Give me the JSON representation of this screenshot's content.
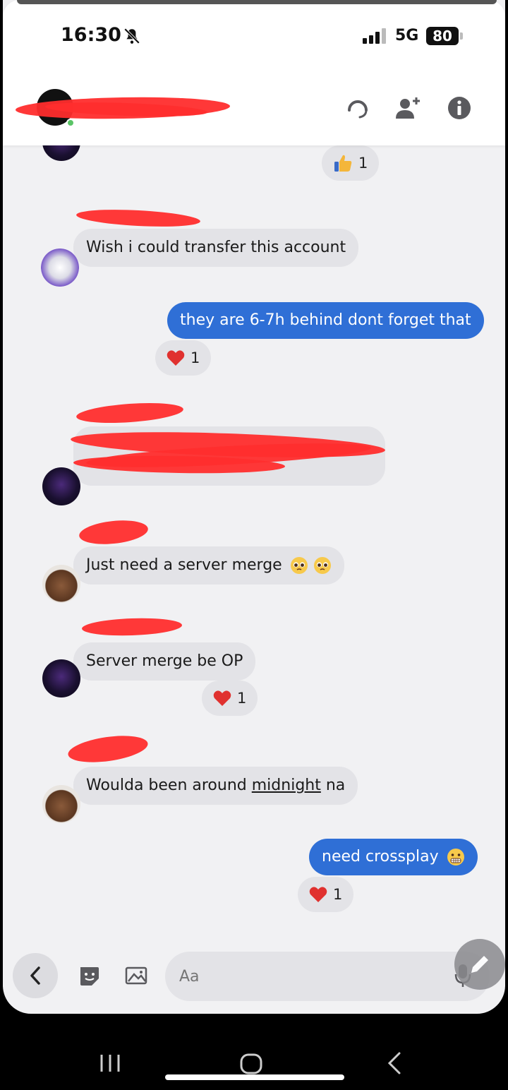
{
  "status_bar": {
    "time": "16:30",
    "network": "5G",
    "battery": "80"
  },
  "header": {
    "contact_name": "",
    "icons": [
      "headset-icon",
      "add-person-icon",
      "info-icon"
    ]
  },
  "messages": [
    {
      "type": "reaction",
      "side": "in",
      "emoji": "thumbs-up",
      "count": "1"
    },
    {
      "type": "incoming",
      "text": "Wish i could transfer this account",
      "avatar": "skull"
    },
    {
      "type": "outgoing",
      "text": "they are 6-7h behind dont forget that"
    },
    {
      "type": "reaction",
      "emoji": "heart",
      "count": "1"
    },
    {
      "type": "incoming",
      "text": "",
      "avatar": "dark"
    },
    {
      "type": "incoming",
      "text": "Just need a server merge",
      "avatar": "beaver",
      "emoji": "pleading-face x2"
    },
    {
      "type": "incoming",
      "text": "Server merge be OP",
      "avatar": "dark"
    },
    {
      "type": "reaction",
      "emoji": "heart",
      "count": "1"
    },
    {
      "type": "incoming",
      "text_before": "Woulda been around ",
      "text_link": "midnight",
      "text_after": " na",
      "avatar": "beaver"
    },
    {
      "type": "outgoing",
      "text": "need crossplay",
      "emoji": "grimacing-face"
    },
    {
      "type": "reaction",
      "emoji": "heart",
      "count": "1"
    }
  ],
  "composer": {
    "placeholder": "Aa"
  },
  "colors": {
    "outgoing_bubble": "#2f6fd6",
    "incoming_bubble": "#e3e3e7",
    "background": "#f1f1f3",
    "redaction": "#ff2d2d"
  }
}
